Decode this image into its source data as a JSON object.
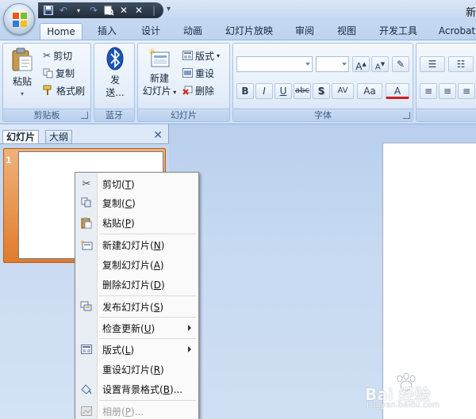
{
  "window": {
    "title": "新"
  },
  "ribbon_tabs": [
    {
      "label": "Home",
      "active": true
    },
    {
      "label": "插入"
    },
    {
      "label": "设计"
    },
    {
      "label": "动画"
    },
    {
      "label": "幻灯片放映"
    },
    {
      "label": "审阅"
    },
    {
      "label": "视图"
    },
    {
      "label": "开发工具"
    },
    {
      "label": "Acrobat"
    }
  ],
  "clipboard": {
    "paste_label": "粘贴",
    "cut_label": "剪切",
    "copy_label": "复制",
    "format_painter_label": "格式刷",
    "group_label": "剪贴板"
  },
  "bluetooth": {
    "send_label_1": "发",
    "send_label_2": "送...",
    "group_label": "蓝牙"
  },
  "slides": {
    "new_slide_label_1": "新建",
    "new_slide_label_2": "幻灯片",
    "layout_label": "版式",
    "reset_label": "重设",
    "delete_label": "删除",
    "group_label": "幻灯片"
  },
  "font": {
    "group_label": "字体",
    "bold": "B",
    "italic": "I",
    "underline": "U",
    "strike": "abc",
    "shadow": "S",
    "spacing": "AV",
    "case": "Aa",
    "color": "A",
    "grow": "A",
    "shrink": "A"
  },
  "left_panel": {
    "tab_slides": "幻灯片",
    "tab_outline": "大纲",
    "close": "✕",
    "slide_number": "1"
  },
  "context_menu": {
    "items": [
      {
        "label": "剪切",
        "key": "T",
        "icon": "scissors-icon"
      },
      {
        "label": "复制",
        "key": "C",
        "icon": "copy-icon"
      },
      {
        "label": "粘贴",
        "key": "P",
        "icon": "paste-icon"
      },
      {
        "label": "新建幻灯片",
        "key": "N",
        "icon": "new-slide-icon"
      },
      {
        "label": "复制幻灯片",
        "key": "A",
        "icon": ""
      },
      {
        "label": "删除幻灯片",
        "key": "D",
        "icon": ""
      },
      {
        "label": "发布幻灯片",
        "key": "S",
        "icon": "publish-icon"
      },
      {
        "label": "检查更新",
        "key": "U",
        "icon": "",
        "submenu": true
      },
      {
        "label": "版式",
        "key": "L",
        "icon": "layout-icon",
        "submenu": true
      },
      {
        "label": "重设幻灯片",
        "key": "R",
        "icon": ""
      },
      {
        "label": "设置背景格式",
        "key": "B",
        "suffix": "...",
        "icon": "background-icon"
      },
      {
        "label": "相册",
        "key": "P",
        "suffix": "...",
        "icon": "photo-album-icon",
        "disabled": true
      }
    ]
  },
  "watermark": {
    "text": "Bai 经验",
    "sub": "jingyan.baidu.com"
  }
}
